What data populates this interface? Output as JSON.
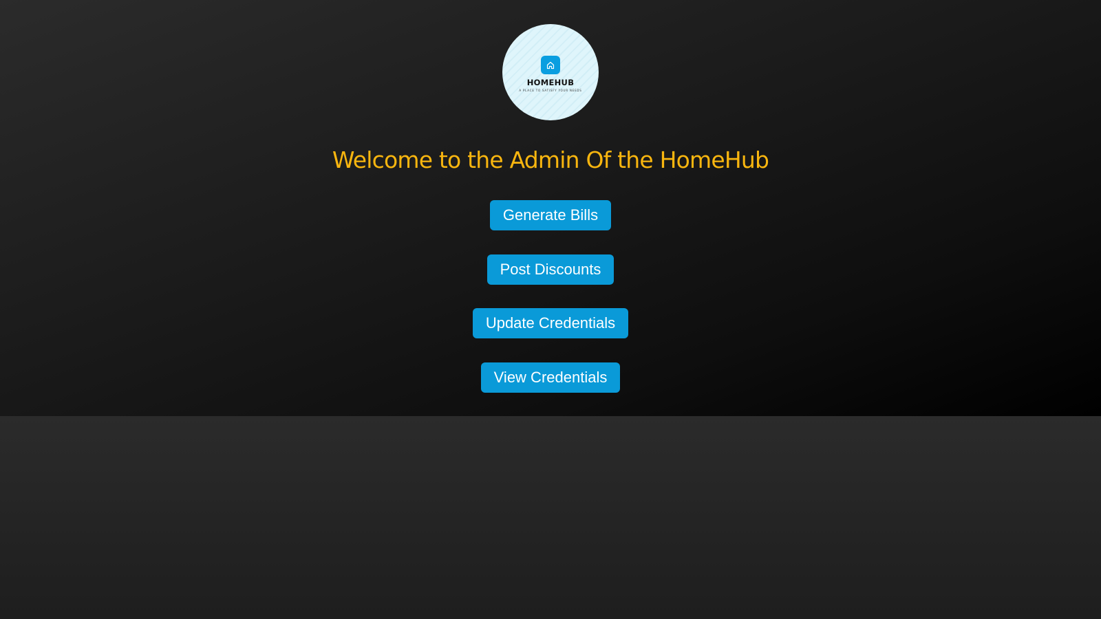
{
  "logo": {
    "name": "HOMEHUB",
    "tagline": "A PLACE TO SATISFY YOUR NEEDS",
    "icon": "home-icon",
    "badge_color": "#0a9ee0",
    "circle_color": "#dff5fb"
  },
  "header": {
    "welcome": "Welcome to the Admin Of the HomeHub"
  },
  "actions": [
    {
      "label": "Generate Bills"
    },
    {
      "label": "Post Discounts"
    },
    {
      "label": "Update Credentials"
    },
    {
      "label": "View Credentials"
    }
  ],
  "colors": {
    "accent": "#f9b60f",
    "button": "#0a9ad8",
    "button_text": "#ffffff"
  }
}
